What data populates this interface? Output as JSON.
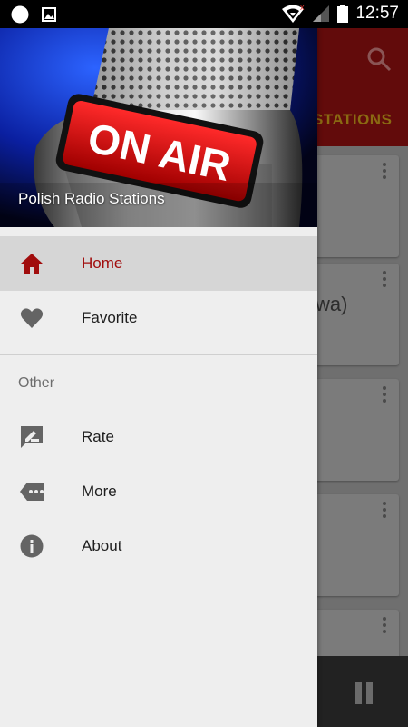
{
  "status_bar": {
    "time": "12:57"
  },
  "drawer": {
    "header_title": "Polish Radio Stations",
    "header_sign": "ON AIR",
    "items": [
      {
        "label": "Home",
        "icon": "home-icon",
        "active": true
      },
      {
        "label": "Favorite",
        "icon": "heart-icon"
      }
    ],
    "section_label": "Other",
    "other_items": [
      {
        "label": "Rate",
        "icon": "rate-icon"
      },
      {
        "label": "More",
        "icon": "more-tag-icon"
      },
      {
        "label": "About",
        "icon": "info-icon"
      }
    ]
  },
  "background_app": {
    "tab_partial": "STATIONS",
    "card_partial_text": "wa)"
  },
  "colors": {
    "accent": "#a10d0d",
    "appbar": "#620b0b",
    "drawer_bg": "#eeeeee"
  }
}
